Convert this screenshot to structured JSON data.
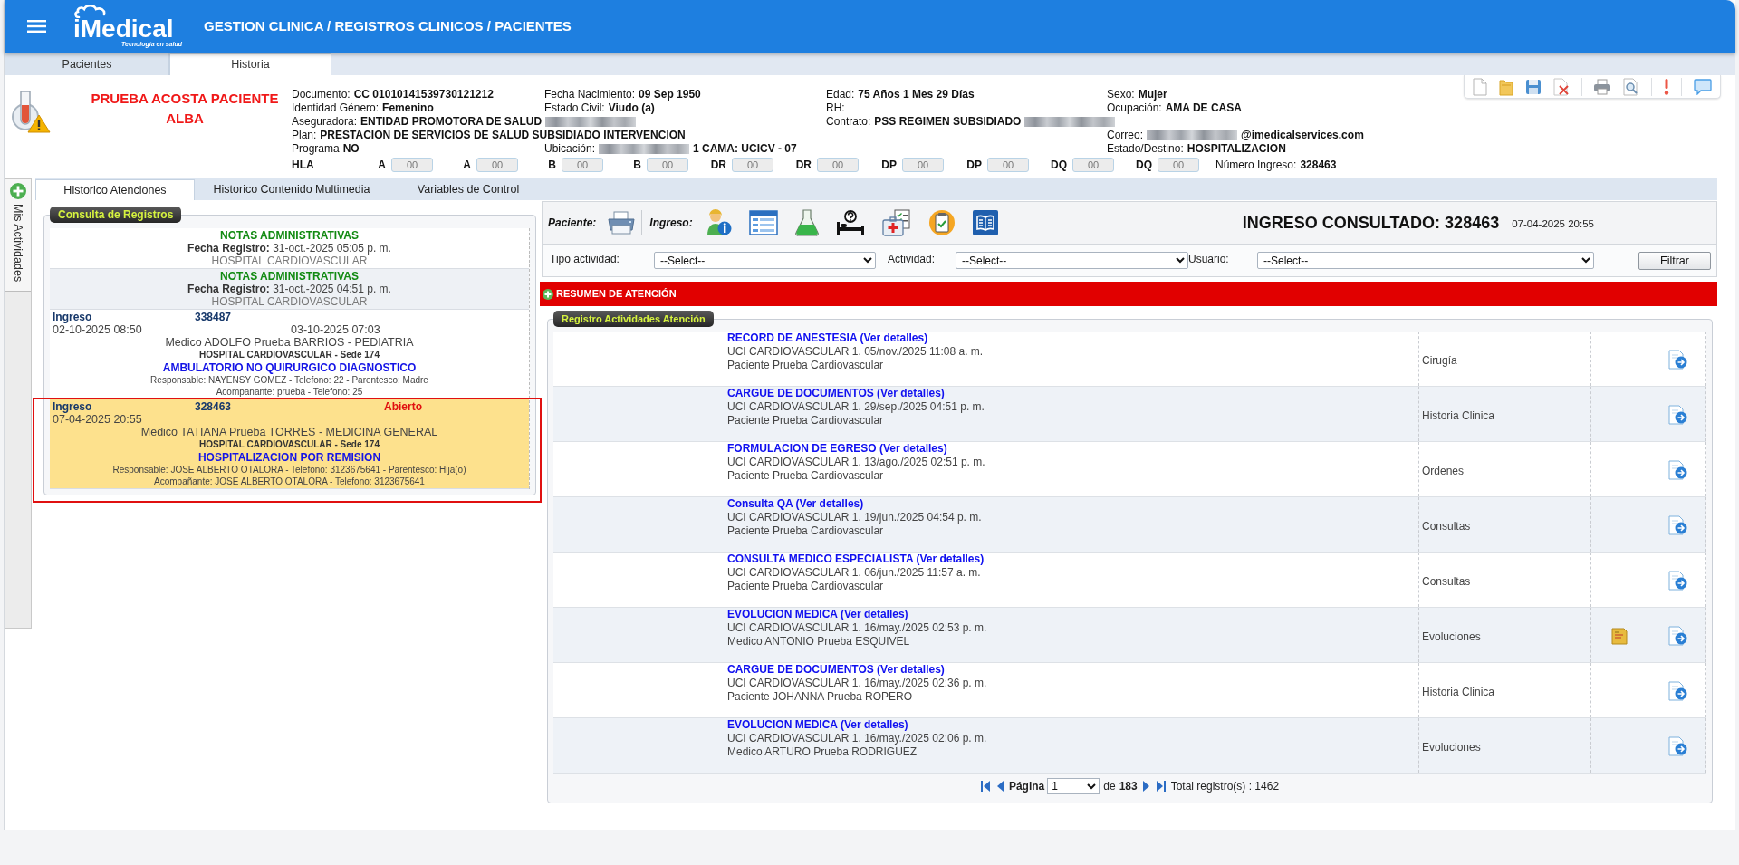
{
  "header": {
    "logo_text": "iMedical",
    "logo_tagline": "Tecnología en salud",
    "title": "GESTION CLINICA / REGISTROS CLINICOS / PACIENTES"
  },
  "top_tabs": [
    {
      "label": "Pacientes",
      "selected": false
    },
    {
      "label": "Historia",
      "selected": true
    }
  ],
  "patient": {
    "name": "PRUEBA ACOSTA PACIENTE ALBA",
    "rows": [
      [
        {
          "label": "Documento:",
          "value": "CC 01010141539730121212"
        },
        {
          "label": "Fecha Nacimiento:",
          "value": "09 Sep 1950"
        },
        {
          "label": "Edad:",
          "value": "75 Años 1 Mes 29 Días"
        },
        {
          "label": "Sexo:",
          "value": "Mujer"
        }
      ],
      [
        {
          "label": "Identidad Género:",
          "value": "Femenino"
        },
        {
          "label": "Estado Civil:",
          "value": "Viudo (a)"
        },
        {
          "label": "RH:"
        },
        {
          "label": "Ocupación:",
          "value": "AMA DE CASA"
        }
      ],
      [
        {
          "label": "Aseguradora:",
          "value": "ENTIDAD PROMOTORA DE SALUD",
          "redacted_after": true
        },
        "",
        {
          "label": "Contrato:",
          "value": "PSS REGIMEN SUBSIDIADO",
          "redacted_after": true
        }
      ],
      [
        {
          "label": "Plan:",
          "value": "PRESTACION DE SERVICIOS DE SALUD SUBSIDIADO INTERVENCION"
        },
        "",
        "",
        {
          "label": "Correo:",
          "value": "@imedicalservices.com",
          "redacted_before": true
        }
      ],
      [
        {
          "label": "Programa",
          "value": "NO"
        },
        {
          "label": "Ubicación:",
          "value": "1 CAMA: UCICV - 07",
          "redacted_before": true
        },
        "",
        {
          "label": "Estado/Destino:",
          "value": "HOSPITALIZACION"
        }
      ]
    ],
    "hla": {
      "label": "HLA",
      "fields": [
        {
          "label": "A",
          "value": "00",
          "disabled": true
        },
        {
          "label": "A",
          "value": "00",
          "disabled": true
        },
        {
          "label": "B",
          "value": "00",
          "disabled": true
        },
        {
          "label": "B",
          "value": "00",
          "disabled": true
        },
        {
          "label": "DR",
          "value": "00",
          "disabled": true
        },
        {
          "label": "DR",
          "value": "00",
          "disabled": true
        },
        {
          "label": "DP",
          "value": "00",
          "disabled": true
        },
        {
          "label": "DP",
          "value": "00",
          "disabled": true
        },
        {
          "label": "DQ",
          "value": "00",
          "disabled": true
        },
        {
          "label": "DQ",
          "value": "00",
          "disabled": true
        }
      ]
    },
    "admission_number": {
      "label": "Número Ingreso:",
      "value": "328463"
    }
  },
  "side_tab": {
    "label": "Mis Actividades"
  },
  "view_tabs": [
    {
      "label": "Historico Atenciones",
      "selected": true
    },
    {
      "label": "Historico Contenido Multimedia",
      "selected": false
    },
    {
      "label": "Variables de Control",
      "selected": false
    }
  ],
  "records_panel": {
    "title": "Consulta de Registros",
    "records": [
      {
        "kind": "note",
        "title": "NOTAS ADMINISTRATIVAS",
        "date_label": "Fecha Registro:",
        "date": "31-oct.-2025 05:05 p. m.",
        "place": "HOSPITAL CARDIOVASCULAR",
        "selected": false,
        "highlighted": false
      },
      {
        "kind": "note",
        "title": "NOTAS ADMINISTRATIVAS",
        "date_label": "Fecha Registro:",
        "date": "31-oct.-2025 04:51 p. m.",
        "place": "HOSPITAL CARDIOVASCULAR",
        "selected": false,
        "highlighted": false
      },
      {
        "kind": "admission",
        "label": "Ingreso",
        "number": "338487",
        "date_in": "02-10-2025 08:50",
        "date_out": "03-10-2025 07:03",
        "doctor": "Medico ADOLFO Prueba BARRIOS - PEDIATRIA",
        "site": "HOSPITAL CARDIOVASCULAR - Sede 174",
        "service": "AMBULATORIO NO QUIRURGICO DIAGNOSTICO",
        "responsible": "Responsable: NAYENSY GOMEZ - Telefono: 22 - Parentesco: Madre",
        "companion": "Acompanante: prueba - Telefono: 25",
        "selected": false,
        "highlighted": false
      },
      {
        "kind": "admission",
        "label": "Ingreso",
        "number": "328463",
        "status": "Abierto",
        "date_in": "07-04-2025 20:55",
        "doctor": "Medico TATIANA Prueba TORRES - MEDICINA GENERAL",
        "site": "HOSPITAL CARDIOVASCULAR - Sede 174",
        "service": "HOSPITALIZACION POR REMISION",
        "responsible": "Responsable: JOSE ALBERTO OTALORA - Telefono: 3123675641 - Parentesco: Hija(o)",
        "companion": "Acompañante: JOSE ALBERTO OTALORA - Telefono: 3123675641",
        "selected": true,
        "highlighted": true
      }
    ]
  },
  "activity_toolbar": {
    "patient_label": "Paciente:",
    "admission_label": "Ingreso:",
    "consulted": "INGRESO CONSULTADO: 328463",
    "consulted_date": "07-04-2025 20:55"
  },
  "filters": [
    {
      "label": "Tipo actividad:",
      "value": "--Select--"
    },
    {
      "label": "Actividad:",
      "value": "--Select--"
    },
    {
      "label": "Usuario:",
      "value": "--Select--"
    }
  ],
  "filter_button": "Filtrar",
  "summary_bar": "RESUMEN DE ATENCIÓN",
  "activities": {
    "title": "Registro Actividades Atención",
    "rows": [
      {
        "title": "RECORD DE ANESTESIA (Ver detalles)",
        "location": "UCI CARDIOVASCULAR 1. 05/nov./2025 11:08 a. m.",
        "author": "Paciente Prueba Cardiovascular",
        "category": "Cirugía",
        "attachment": false
      },
      {
        "title": "CARGUE DE DOCUMENTOS (Ver detalles)",
        "location": "UCI CARDIOVASCULAR 1. 29/sep./2025 04:51 p. m.",
        "author": "Paciente Prueba Cardiovascular",
        "category": "Historia Clinica",
        "attachment": false
      },
      {
        "title": "FORMULACION DE EGRESO (Ver detalles)",
        "location": "UCI CARDIOVASCULAR 1. 13/ago./2025 02:51 p. m.",
        "author": "Paciente Prueba Cardiovascular",
        "category": "Ordenes",
        "attachment": false
      },
      {
        "title": "Consulta QA (Ver detalles)",
        "location": "UCI CARDIOVASCULAR 1. 19/jun./2025 04:54 p. m.",
        "author": "Paciente Prueba Cardiovascular",
        "category": "Consultas",
        "attachment": false
      },
      {
        "title": "CONSULTA MEDICO ESPECIALISTA (Ver detalles)",
        "location": "UCI CARDIOVASCULAR 1. 06/jun./2025 11:57 a. m.",
        "author": "Paciente Prueba Cardiovascular",
        "category": "Consultas",
        "attachment": false
      },
      {
        "title": "EVOLUCION MEDICA (Ver detalles)",
        "location": "UCI CARDIOVASCULAR 1. 16/may./2025 02:53 p. m.",
        "author": "Medico ANTONIO Prueba ESQUIVEL",
        "category": "Evoluciones",
        "attachment": true
      },
      {
        "title": "CARGUE DE DOCUMENTOS (Ver detalles)",
        "location": "UCI CARDIOVASCULAR 1. 16/may./2025 02:36 p. m.",
        "author": "Paciente JOHANNA Prueba ROPERO",
        "category": "Historia Clinica",
        "attachment": false
      },
      {
        "title": "EVOLUCION MEDICA (Ver detalles)",
        "location": "UCI CARDIOVASCULAR 1. 16/may./2025 02:06 p. m.",
        "author": "Medico ARTURO Prueba RODRIGUEZ",
        "category": "Evoluciones",
        "attachment": false
      }
    ],
    "pagination": {
      "page_label": "Página",
      "page": "1",
      "of_label": "de",
      "total_pages": "183",
      "total": "Total registro(s) : 1462"
    }
  }
}
